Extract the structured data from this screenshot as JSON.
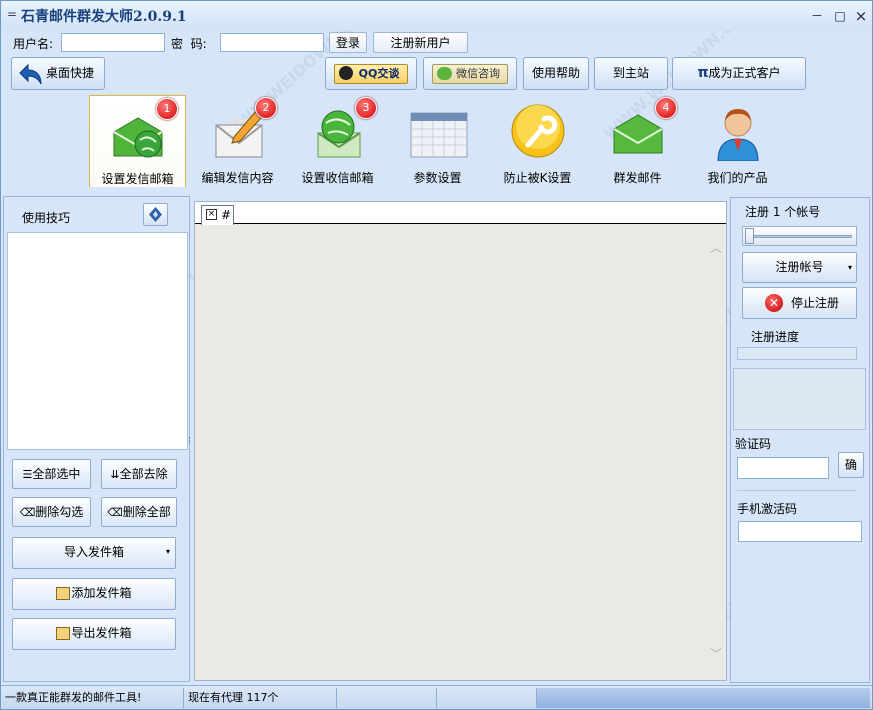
{
  "window": {
    "title": "石青邮件群发大师2.0.9.1",
    "sysmenu_icon": "=",
    "minimize": "－",
    "maximize": "□",
    "close": "×"
  },
  "login": {
    "username_label": "用户名:",
    "password_label": "密  码:",
    "username_value": "",
    "password_value": "",
    "login_button": "登录",
    "register_button": "注册新用户"
  },
  "toolbar": {
    "desktop_shortcut": "桌面快捷",
    "qq": "QQ交谈",
    "wechat": "微信咨询",
    "help": "使用帮助",
    "home": "到主站",
    "become_customer": "成为正式客户",
    "become_customer_icon": "π"
  },
  "nav": [
    {
      "label": "设置发信邮箱",
      "badge": "1"
    },
    {
      "label": "编辑发信内容",
      "badge": "2"
    },
    {
      "label": "设置收信邮箱",
      "badge": "3"
    },
    {
      "label": "参数设置",
      "badge": ""
    },
    {
      "label": "防止被K设置",
      "badge": ""
    },
    {
      "label": "群发邮件",
      "badge": "4"
    },
    {
      "label": "我们的产品",
      "badge": ""
    }
  ],
  "left": {
    "tips_label": "使用技巧",
    "select_all": "全部选中",
    "remove_all": "全部去除",
    "delete_checked": "删除勾选",
    "delete_all": "删除全部",
    "import_outbox": "导入发件箱",
    "add_outbox": "添加发件箱",
    "export_outbox": "导出发件箱"
  },
  "center": {
    "tab_close": "×",
    "tab_label": "#"
  },
  "right": {
    "register_count": "注册 1 个帐号",
    "register_account": "注册帐号",
    "stop_register": "停止注册",
    "progress_label": "注册进度",
    "captcha_label": "验证码",
    "captcha_confirm": "确",
    "sms_label": "手机激活码",
    "slider_value": 0
  },
  "status": {
    "slogan": "一款真正能群发的邮件工具!",
    "proxy": "现在有代理 117个"
  },
  "watermark": "WWW.WEIDOWN.COM",
  "colors": {
    "accent": "#1a3f7a",
    "badge": "#d40000",
    "active_tab_border": "#e0b34c"
  }
}
